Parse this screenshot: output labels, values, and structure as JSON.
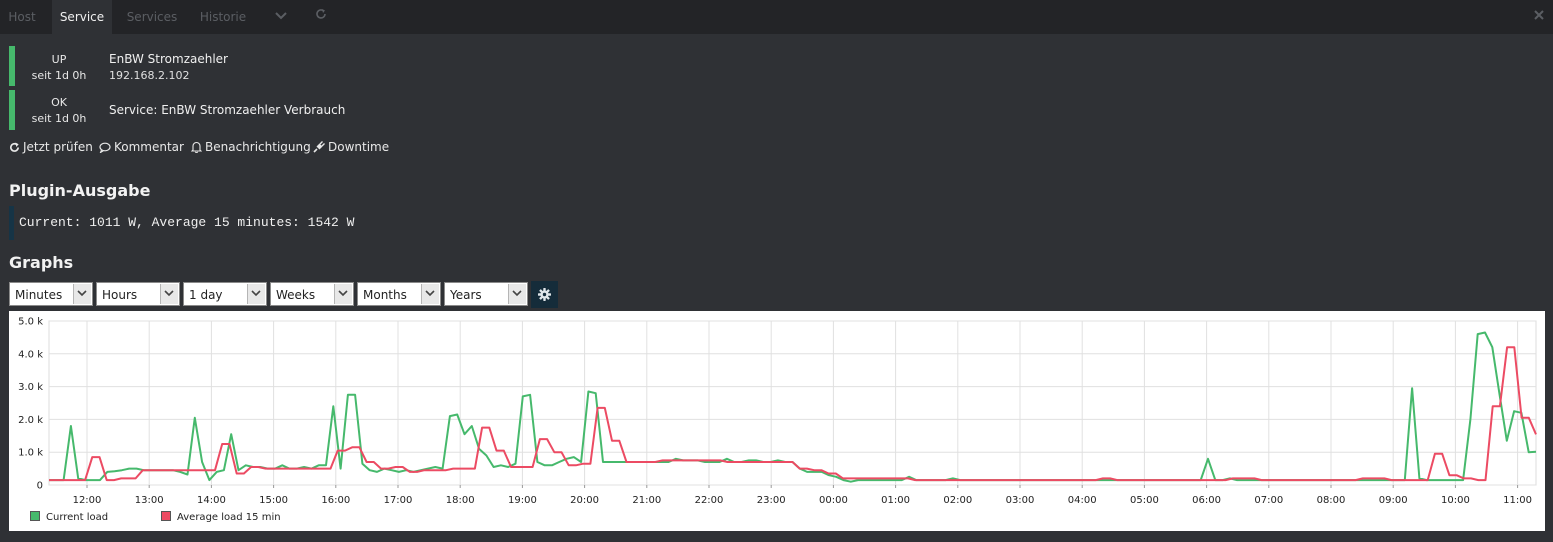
{
  "tabs": [
    {
      "label": "Host",
      "active": false
    },
    {
      "label": "Service",
      "active": true
    },
    {
      "label": "Services",
      "active": false
    },
    {
      "label": "Historie",
      "active": false
    }
  ],
  "host_state": {
    "state": "UP",
    "since": "seit 1d 0h",
    "name": "EnBW Stromzaehler",
    "address": "192.168.2.102",
    "color": "#46b96c"
  },
  "service_state": {
    "state": "OK",
    "since": "seit 1d 0h",
    "name": "Service: EnBW Stromzaehler Verbrauch",
    "color": "#46b96c"
  },
  "actions": [
    {
      "label": "Jetzt prüfen",
      "icon": "refresh-icon"
    },
    {
      "label": "Kommentar",
      "icon": "comment-icon"
    },
    {
      "label": "Benachrichtigung",
      "icon": "bell-icon"
    },
    {
      "label": "Downtime",
      "icon": "plug-icon"
    }
  ],
  "plugin_output": {
    "heading": "Plugin-Ausgabe",
    "text": "Current: 1011 W, Average 15 minutes: 1542 W"
  },
  "graphs": {
    "heading": "Graphs",
    "selects": [
      "Minutes",
      "Hours",
      "1 day",
      "Weeks",
      "Months",
      "Years"
    ]
  },
  "chart_data": {
    "type": "line",
    "x_ticks": [
      "12:00",
      "13:00",
      "14:00",
      "15:00",
      "16:00",
      "17:00",
      "18:00",
      "19:00",
      "20:00",
      "21:00",
      "22:00",
      "23:00",
      "00:00",
      "01:00",
      "02:00",
      "03:00",
      "04:00",
      "05:00",
      "06:00",
      "07:00",
      "08:00",
      "09:00",
      "10:00",
      "11:00"
    ],
    "y_ticks": [
      "0",
      "1.0 k",
      "2.0 k",
      "3.0 k",
      "4.0 k",
      "5.0 k"
    ],
    "ylim": [
      0,
      5000
    ],
    "grid": true,
    "legend_position": "bottom-left",
    "series": [
      {
        "name": "Current load",
        "color": "#46b96c",
        "values": [
          150,
          150,
          150,
          1800,
          200,
          150,
          150,
          150,
          400,
          420,
          450,
          500,
          500,
          450,
          450,
          450,
          450,
          450,
          400,
          320,
          2050,
          700,
          150,
          400,
          450,
          1550,
          450,
          600,
          550,
          550,
          500,
          500,
          600,
          500,
          500,
          550,
          500,
          600,
          600,
          2400,
          500,
          2750,
          2750,
          650,
          450,
          400,
          500,
          450,
          400,
          450,
          400,
          450,
          500,
          550,
          500,
          2100,
          2150,
          1550,
          1800,
          1100,
          900,
          550,
          600,
          550,
          650,
          2700,
          2750,
          700,
          600,
          600,
          700,
          800,
          850,
          700,
          2850,
          2800,
          700,
          700,
          700,
          700,
          700,
          700,
          700,
          700,
          700,
          700,
          800,
          750,
          750,
          750,
          700,
          700,
          700,
          800,
          700,
          700,
          750,
          750,
          700,
          700,
          750,
          700,
          700,
          500,
          400,
          400,
          400,
          300,
          250,
          150,
          100,
          150,
          150,
          150,
          150,
          150,
          150,
          150,
          250,
          150,
          150,
          150,
          150,
          150,
          200,
          150,
          150,
          150,
          150,
          150,
          150,
          150,
          150,
          150,
          150,
          150,
          150,
          150,
          150,
          150,
          150,
          150,
          150,
          150,
          150,
          150,
          150,
          150,
          150,
          150,
          150,
          150,
          150,
          150,
          150,
          150,
          150,
          150,
          150,
          800,
          150,
          150,
          200,
          150,
          150,
          150,
          150,
          150,
          150,
          150,
          150,
          150,
          150,
          150,
          150,
          150,
          150,
          150,
          150,
          150,
          150,
          150,
          150,
          150,
          150,
          150,
          150,
          2950,
          200,
          150,
          150,
          150,
          150,
          150,
          150,
          2000,
          4600,
          4650,
          4200,
          2750,
          1350,
          2250,
          2200,
          1000,
          1011
        ]
      },
      {
        "name": "Average load 15 min",
        "color": "#ec4b63",
        "values": [
          150,
          150,
          150,
          150,
          150,
          150,
          850,
          850,
          150,
          150,
          200,
          200,
          200,
          450,
          450,
          450,
          450,
          450,
          450,
          450,
          450,
          450,
          450,
          450,
          1250,
          1250,
          350,
          350,
          550,
          550,
          500,
          500,
          500,
          500,
          500,
          500,
          500,
          500,
          500,
          500,
          1050,
          1050,
          1150,
          1150,
          700,
          700,
          500,
          500,
          550,
          550,
          400,
          400,
          450,
          450,
          450,
          450,
          500,
          500,
          500,
          500,
          1750,
          1750,
          1050,
          1050,
          550,
          550,
          550,
          550,
          1400,
          1400,
          1000,
          1000,
          600,
          600,
          650,
          650,
          2350,
          2350,
          1350,
          1350,
          700,
          700,
          700,
          700,
          700,
          750,
          750,
          750,
          750,
          750,
          750,
          750,
          750,
          750,
          700,
          700,
          700,
          700,
          700,
          700,
          700,
          700,
          700,
          700,
          500,
          500,
          450,
          450,
          350,
          350,
          200,
          200,
          200,
          200,
          200,
          200,
          200,
          200,
          200,
          200,
          150,
          150,
          150,
          150,
          150,
          150,
          150,
          150,
          150,
          150,
          150,
          150,
          150,
          150,
          150,
          150,
          150,
          150,
          150,
          150,
          150,
          150,
          150,
          150,
          150,
          150,
          200,
          200,
          150,
          150,
          150,
          150,
          150,
          150,
          150,
          150,
          150,
          150,
          150,
          150,
          150,
          150,
          150,
          150,
          200,
          200,
          200,
          200,
          150,
          150,
          150,
          150,
          150,
          150,
          150,
          150,
          150,
          150,
          150,
          150,
          150,
          150,
          200,
          200,
          200,
          200,
          150,
          150,
          150,
          150,
          150,
          150,
          950,
          950,
          300,
          300,
          200,
          200,
          150,
          150,
          2400,
          2400,
          4200,
          4200,
          2050,
          2050,
          1542
        ]
      }
    ]
  }
}
